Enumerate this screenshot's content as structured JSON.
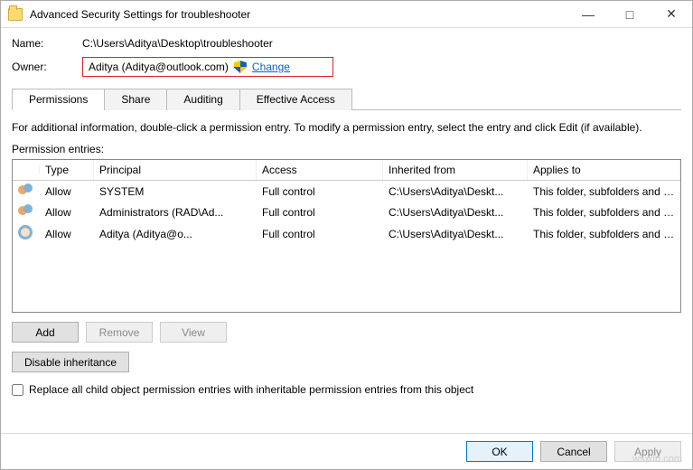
{
  "window": {
    "title": "Advanced Security Settings for troubleshooter"
  },
  "labels": {
    "name": "Name:",
    "owner": "Owner:",
    "permission_entries": "Permission entries:",
    "help": "For additional information, double-click a permission entry. To modify a permission entry, select the entry and click Edit (if available)."
  },
  "values": {
    "path": "C:\\Users\\Aditya\\Desktop\\troubleshooter",
    "owner": "Aditya (Aditya@outlook.com)",
    "change": "Change"
  },
  "tabs": [
    {
      "label": "Permissions",
      "active": true
    },
    {
      "label": "Share",
      "active": false
    },
    {
      "label": "Auditing",
      "active": false
    },
    {
      "label": "Effective Access",
      "active": false
    }
  ],
  "grid": {
    "headers": [
      "",
      "Type",
      "Principal",
      "Access",
      "Inherited from",
      "Applies to"
    ],
    "rows": [
      {
        "icon": "group",
        "type": "Allow",
        "principal": "SYSTEM",
        "access": "Full control",
        "inherited": "C:\\Users\\Aditya\\Deskt...",
        "applies": "This folder, subfolders and files"
      },
      {
        "icon": "group",
        "type": "Allow",
        "principal": "Administrators (RAD\\Ad...",
        "access": "Full control",
        "inherited": "C:\\Users\\Aditya\\Deskt...",
        "applies": "This folder, subfolders and files"
      },
      {
        "icon": "user",
        "type": "Allow",
        "principal": "Aditya (Aditya@o...",
        "access": "Full control",
        "inherited": "C:\\Users\\Aditya\\Deskt...",
        "applies": "This folder, subfolders and files"
      }
    ]
  },
  "buttons": {
    "add": "Add",
    "remove": "Remove",
    "view": "View",
    "disable_inheritance": "Disable inheritance",
    "ok": "OK",
    "cancel": "Cancel",
    "apply": "Apply"
  },
  "checkbox": {
    "replace": "Replace all child object permission entries with inheritable permission entries from this object"
  },
  "watermark": "wsxdn.com"
}
